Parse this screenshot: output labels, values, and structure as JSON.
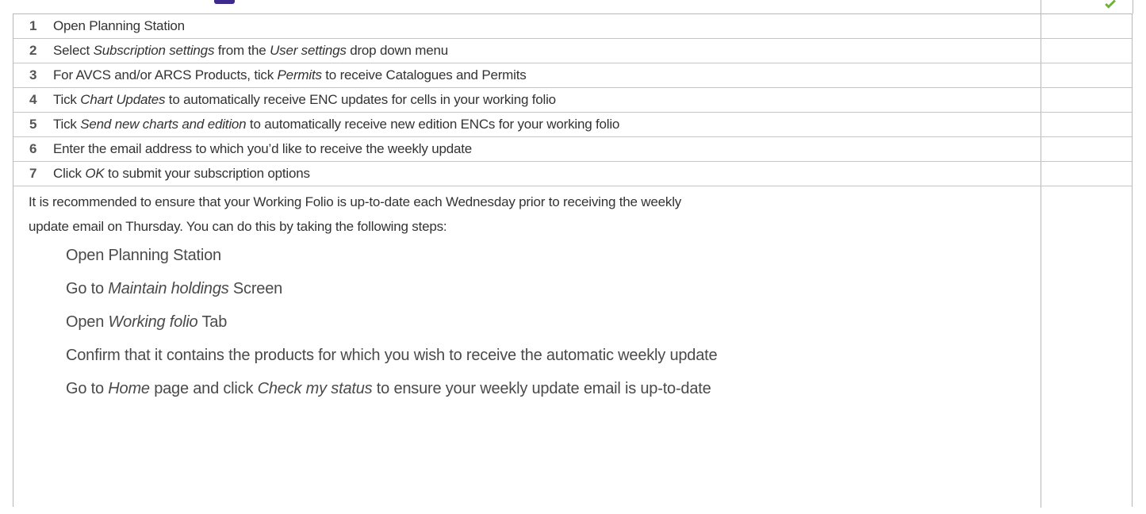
{
  "colors": {
    "heading": "#3d2a8c",
    "check": "#6fb23b",
    "border": "#b7b7b7"
  },
  "rows": [
    {
      "num": "1",
      "parts": [
        {
          "t": "Open Planning Station"
        }
      ]
    },
    {
      "num": "2",
      "parts": [
        {
          "t": "Select "
        },
        {
          "t": "Subscription settings",
          "i": true
        },
        {
          "t": " from the "
        },
        {
          "t": "User settings",
          "i": true
        },
        {
          "t": " drop down menu"
        }
      ]
    },
    {
      "num": "3",
      "parts": [
        {
          "t": "For AVCS and/or ARCS Products, tick "
        },
        {
          "t": "Permits",
          "i": true
        },
        {
          "t": " to receive Catalogues and Permits"
        }
      ]
    },
    {
      "num": "4",
      "parts": [
        {
          "t": "Tick "
        },
        {
          "t": "Chart Updates",
          "i": true
        },
        {
          "t": " to automatically receive ENC updates for cells in your working folio"
        }
      ]
    },
    {
      "num": "5",
      "parts": [
        {
          "t": "Tick "
        },
        {
          "t": "Send new charts and edition",
          "i": true
        },
        {
          "t": " to automatically receive new edition ENCs for your working folio"
        }
      ]
    },
    {
      "num": "6",
      "parts": [
        {
          "t": "Enter the email address to which you’d like to receive the weekly update"
        }
      ]
    },
    {
      "num": "7",
      "parts": [
        {
          "t": "Click "
        },
        {
          "t": "OK",
          "i": true
        },
        {
          "t": " to submit your subscription options"
        }
      ]
    }
  ],
  "note": {
    "line1": "It is recommended to ensure that your Working Folio is up-to-date each Wednesday prior to receiving the weekly",
    "line2": "update email on Thursday. You can do this by taking the following steps:"
  },
  "steps": [
    {
      "parts": [
        {
          "t": "Open Planning Station"
        }
      ]
    },
    {
      "parts": [
        {
          "t": "Go to "
        },
        {
          "t": "Maintain holdings",
          "i": true
        },
        {
          "t": " Screen"
        }
      ]
    },
    {
      "parts": [
        {
          "t": "Open "
        },
        {
          "t": "Working folio",
          "i": true
        },
        {
          "t": " Tab"
        }
      ]
    },
    {
      "parts": [
        {
          "t": "Confirm that it contains the products for which you wish to receive the automatic weekly update"
        }
      ]
    },
    {
      "parts": [
        {
          "t": "Go to "
        },
        {
          "t": "Home",
          "i": true
        },
        {
          "t": " page and click "
        },
        {
          "t": "Check my status",
          "i": true
        },
        {
          "t": " to ensure your weekly update email is up-to-date"
        }
      ]
    }
  ]
}
